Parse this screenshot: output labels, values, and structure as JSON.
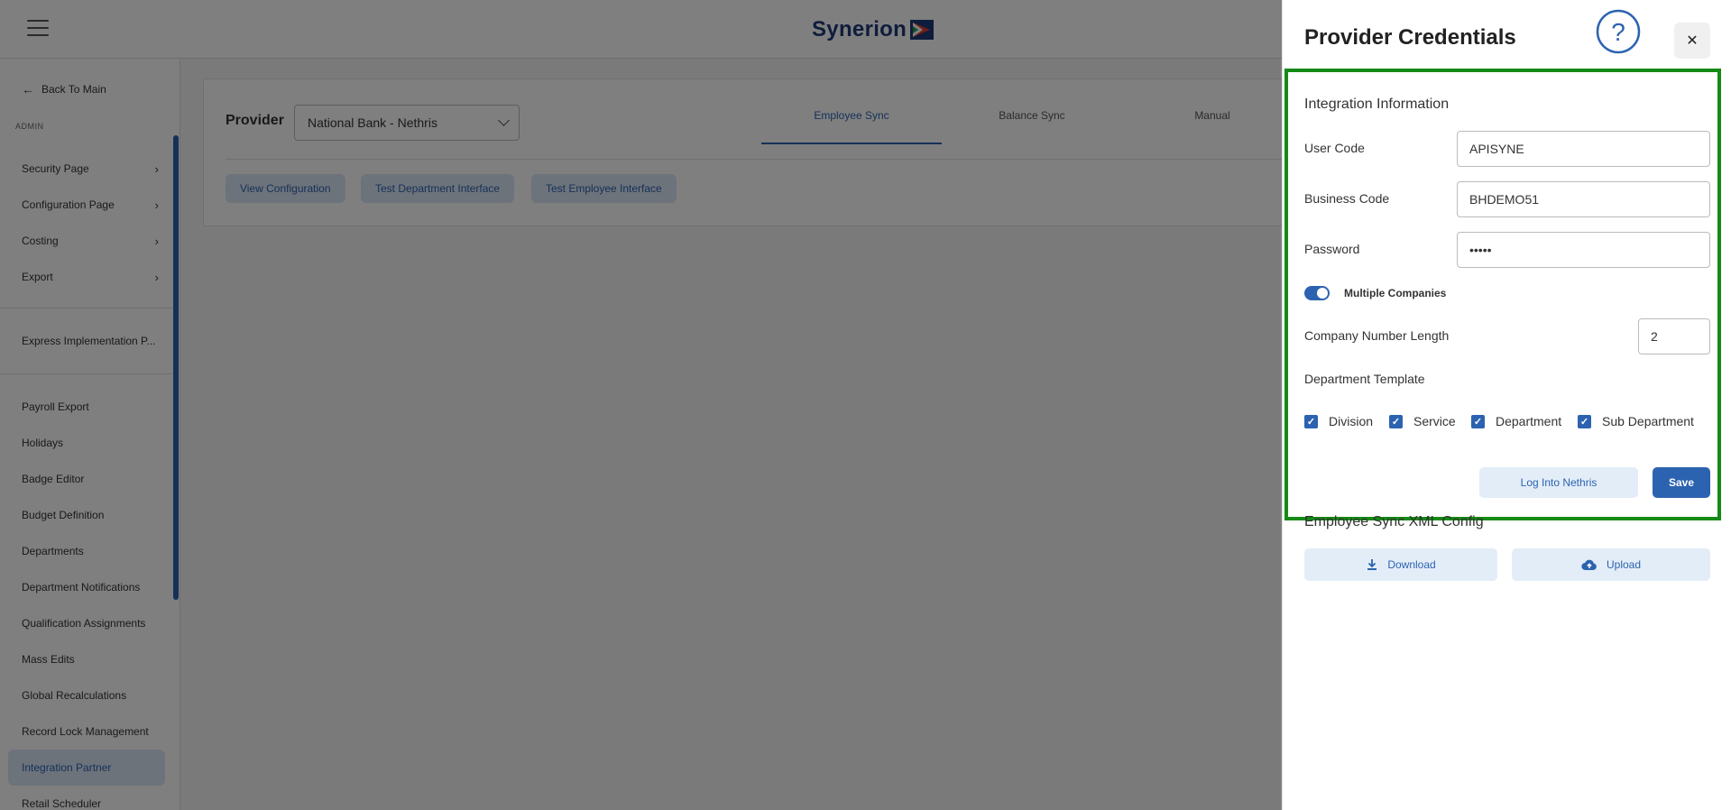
{
  "header": {
    "logo_text": "Synerion"
  },
  "sidebar": {
    "back_label": "Back To Main",
    "section_label": "ADMIN",
    "expandable": [
      {
        "label": "Security Page"
      },
      {
        "label": "Configuration Page"
      },
      {
        "label": "Costing"
      },
      {
        "label": "Export"
      }
    ],
    "express_label": "Express Implementation P...",
    "items": [
      {
        "label": "Payroll Export"
      },
      {
        "label": "Holidays"
      },
      {
        "label": "Badge Editor"
      },
      {
        "label": "Budget Definition"
      },
      {
        "label": "Departments"
      },
      {
        "label": "Department Notifications"
      },
      {
        "label": "Qualification Assignments"
      },
      {
        "label": "Mass Edits"
      },
      {
        "label": "Global Recalculations"
      },
      {
        "label": "Record Lock Management"
      },
      {
        "label": "Integration Partner"
      },
      {
        "label": "Retail Scheduler"
      }
    ]
  },
  "main": {
    "provider_label": "Provider",
    "provider_value": "National Bank - Nethris",
    "tabs": [
      {
        "label": "Employee Sync"
      },
      {
        "label": "Balance Sync"
      },
      {
        "label": "Manual"
      }
    ],
    "buttons": [
      {
        "label": "View Configuration"
      },
      {
        "label": "Test Department Interface"
      },
      {
        "label": "Test Employee Interface"
      }
    ]
  },
  "panel": {
    "title": "Provider Credentials",
    "section_title": "Integration Information",
    "fields": {
      "user_code": {
        "label": "User Code",
        "value": "APISYNE"
      },
      "business_code": {
        "label": "Business Code",
        "value": "BHDEMO51"
      },
      "password": {
        "label": "Password",
        "value": "•••••"
      }
    },
    "toggle_label": "Multiple Companies",
    "company_length_label": "Company Number Length",
    "company_length_value": "2",
    "department_template_label": "Department Template",
    "checks": [
      {
        "label": "Division"
      },
      {
        "label": "Service"
      },
      {
        "label": "Department"
      },
      {
        "label": "Sub Department"
      }
    ],
    "login_label": "Log Into Nethris",
    "save_label": "Save",
    "xml_title": "Employee Sync XML Config",
    "download_label": "Download",
    "upload_label": "Upload"
  },
  "colors": {
    "accent": "#2c63b0",
    "highlight_border": "#158a15",
    "overlay": "rgba(0,0,0,0.5)"
  }
}
